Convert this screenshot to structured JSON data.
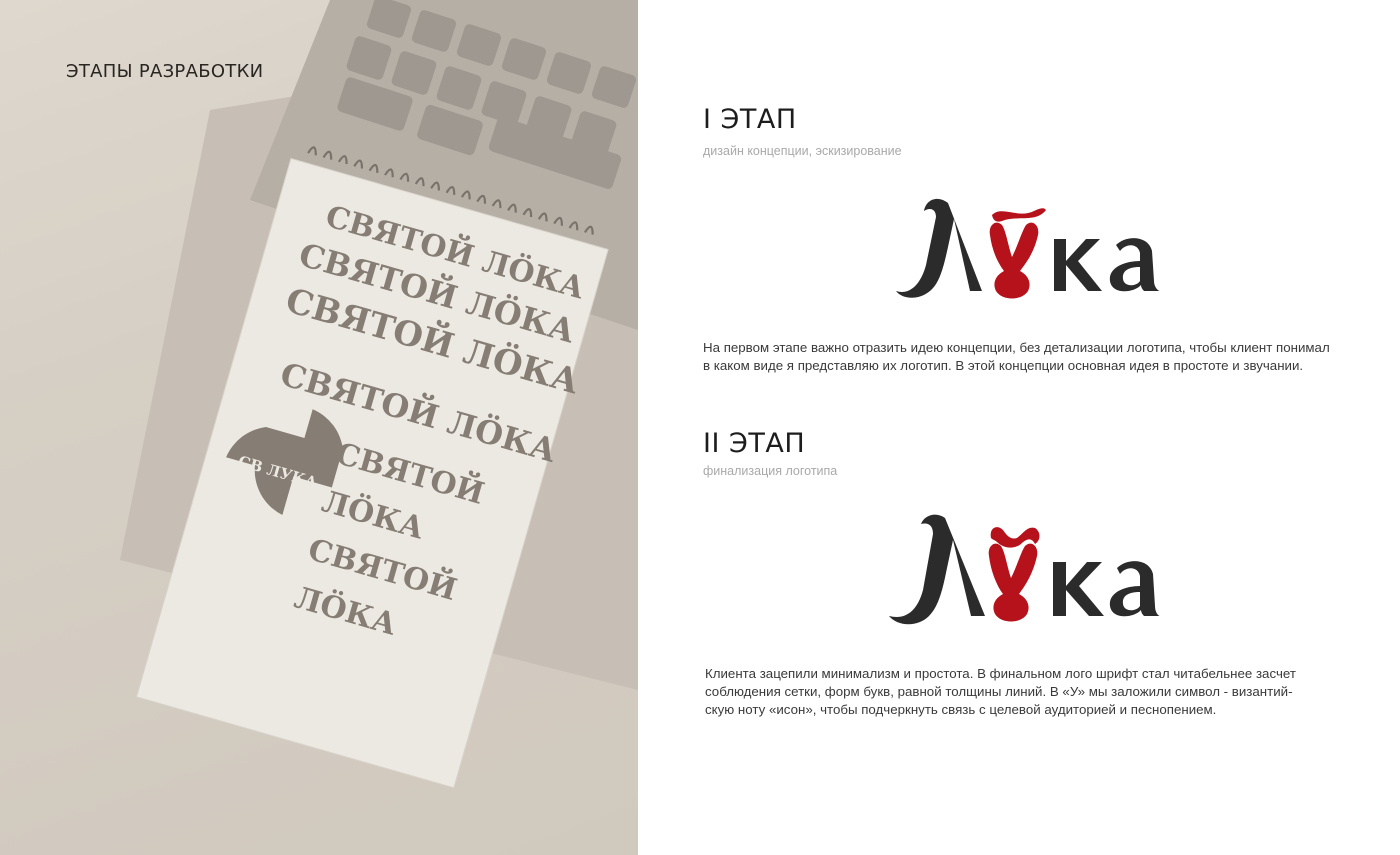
{
  "left_panel": {
    "title": "ЭТАПЫ РАЗРАБОТКИ",
    "sketch_lines": [
      "СВЯТОЙ ЛӦКА",
      "СВЯТОЙ ЛӦКА",
      "СВЯТОЙ ЛӦКА",
      "СВЯТОЙ ЛӦКА",
      "СВЯТОЙ",
      "ЛӦКА",
      "СВЯТОЙ",
      "ЛӦКА"
    ],
    "cross_emblem_text": "СВ ЛУКА"
  },
  "stages": [
    {
      "title": "I ЭТАП",
      "subtitle": "дизайн концепции, эскизирование",
      "logo_text": "Лӱка",
      "description_lines": [
        "На первом этапе важно отразить идею концепции, без детализации логотипа, чтобы клиент понимал",
        "в каком виде я представляю их логотип. В этой концепции основная идея в простоте и звучании."
      ]
    },
    {
      "title": "II ЭТАП",
      "subtitle": "финализация логотипа",
      "logo_text": "Лӱка",
      "description_lines": [
        "Клиента зацепили минимализм и простота.  В финальном лого шрифт стал читабельнее засчет",
        "соблюдения сетки, форм букв, равной толщины линий. В «У» мы заложили символ - византий-",
        "скую ноту «исон», чтобы подчеркнуть связь с целевой аудиторией и песнопением."
      ]
    }
  ],
  "colors": {
    "logo_dark": "#2b2b2b",
    "logo_red": "#b5121b",
    "sketch": "#6e655c"
  }
}
